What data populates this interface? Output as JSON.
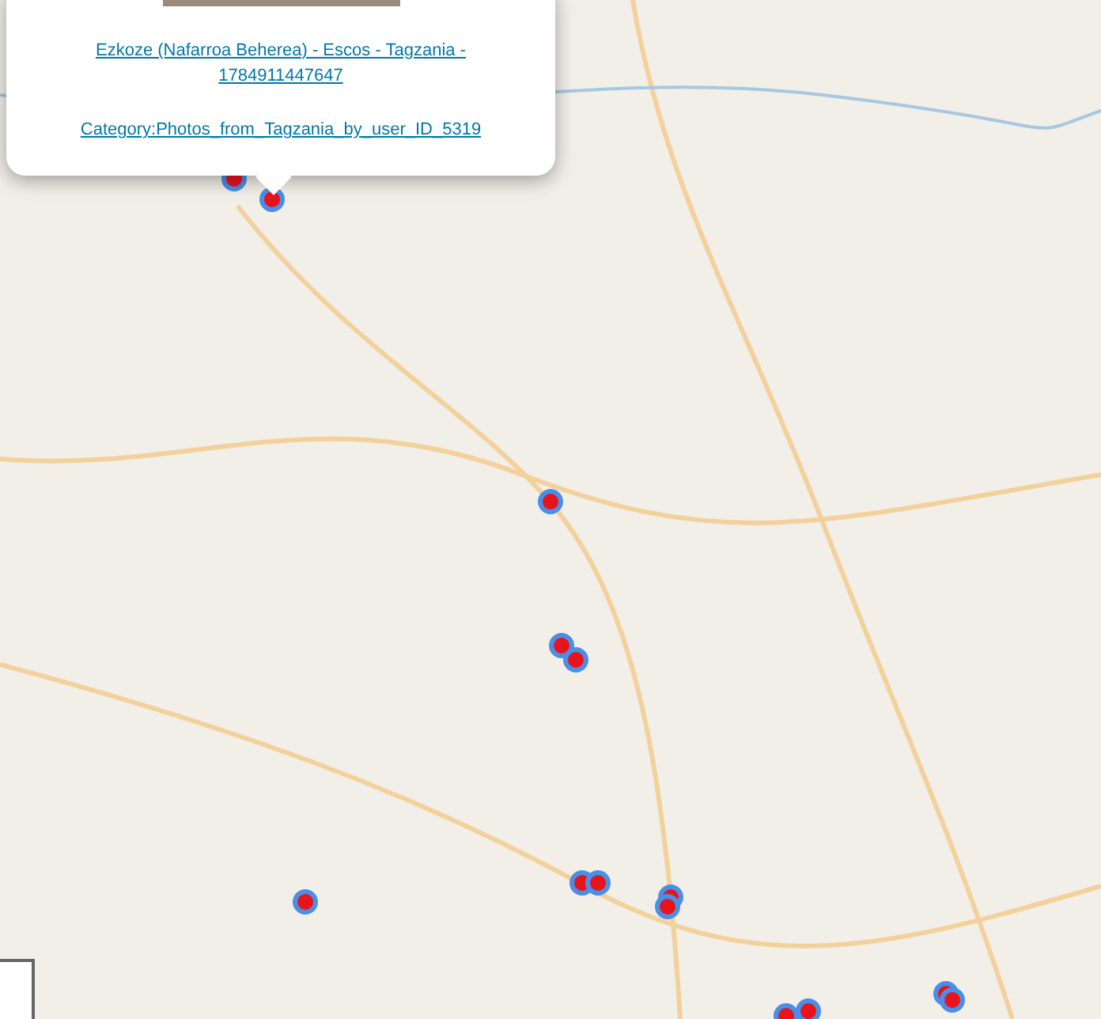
{
  "popup": {
    "links": [
      {
        "text": "Ezkoze (Nafarroa Beherea) - Escos - Tagzania - 1784911447647"
      },
      {
        "text": "Category:Photos_from_Tagzania_by_user_ID_5319"
      }
    ]
  }
}
